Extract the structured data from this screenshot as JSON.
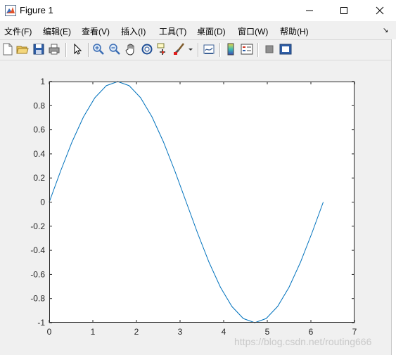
{
  "window": {
    "title": "Figure 1"
  },
  "menu": {
    "items": [
      {
        "label": "文件(F)"
      },
      {
        "label": "编辑(E)"
      },
      {
        "label": "查看(V)"
      },
      {
        "label": "插入(I)"
      },
      {
        "label": "工具(T)"
      },
      {
        "label": "桌面(D)"
      },
      {
        "label": "窗口(W)"
      },
      {
        "label": "帮助(H)"
      }
    ]
  },
  "toolbar": {
    "icons": [
      "new-figure-icon",
      "open-file-icon",
      "save-icon",
      "print-icon",
      "edit-plot-arrow-icon",
      "zoom-in-icon",
      "zoom-out-icon",
      "pan-hand-icon",
      "rotate-3d-icon",
      "data-cursor-icon",
      "brush-icon",
      "brush-dropdown-icon",
      "link-plot-icon",
      "insert-colorbar-icon",
      "insert-legend-icon",
      "hide-plot-tools-icon",
      "show-plot-tools-icon"
    ]
  },
  "watermark": "https://blog.csdn.net/routing666",
  "colors": {
    "line": "#0072BD",
    "axes_bg": "#ffffff",
    "figure_bg": "#f0f0f0"
  },
  "chart_data": {
    "type": "line",
    "title": "",
    "xlabel": "",
    "ylabel": "",
    "xlim": [
      0,
      7
    ],
    "ylim": [
      -1,
      1
    ],
    "xticks": [
      "0",
      "1",
      "2",
      "3",
      "4",
      "5",
      "6",
      "7"
    ],
    "yticks": [
      "-1",
      "-0.8",
      "-0.6",
      "-0.4",
      "-0.2",
      "0",
      "0.2",
      "0.4",
      "0.6",
      "0.8",
      "1"
    ],
    "grid": false,
    "series": [
      {
        "x": [
          0,
          0.2618,
          0.5236,
          0.7854,
          1.0472,
          1.309,
          1.5708,
          1.8326,
          2.0944,
          2.3562,
          2.618,
          2.8798,
          3.1416,
          3.4034,
          3.6652,
          3.927,
          4.1888,
          4.4506,
          4.7124,
          4.9742,
          5.236,
          5.4978,
          5.7596,
          6.0214,
          6.2832
        ],
        "y": [
          0,
          0.2588,
          0.5,
          0.7071,
          0.866,
          0.9659,
          1,
          0.9659,
          0.866,
          0.7071,
          0.5,
          0.2588,
          0,
          -0.2588,
          -0.5,
          -0.7071,
          -0.866,
          -0.9659,
          -1,
          -0.9659,
          -0.866,
          -0.7071,
          -0.5,
          -0.2588,
          0
        ]
      }
    ]
  }
}
